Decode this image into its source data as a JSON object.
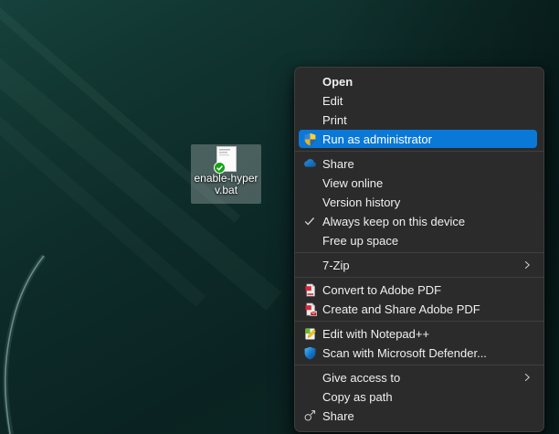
{
  "desktop": {
    "file_icon": {
      "label_lines": [
        "enable-hyper",
        "v.bat"
      ],
      "full_name": "enable-hyperv.bat",
      "sync_badge": "onedrive-synced-check-icon",
      "selected": true
    },
    "colors": {
      "wallpaper_base": "#0d2b29",
      "selection_tile": "rgba(158,168,168,0.42)"
    }
  },
  "context_menu": {
    "colors": {
      "background": "#2b2b2b",
      "highlight": "#0a78d7",
      "text": "#f0f0f0",
      "separator": "#3f3f3f"
    },
    "groups": [
      {
        "items": [
          {
            "label": "Open",
            "bold": true
          },
          {
            "label": "Edit"
          },
          {
            "label": "Print"
          },
          {
            "label": "Run as administrator",
            "icon": "uac-shield-icon",
            "highlighted": true
          }
        ]
      },
      {
        "items": [
          {
            "label": "Share",
            "icon": "onedrive-cloud-icon"
          },
          {
            "label": "View online"
          },
          {
            "label": "Version history"
          },
          {
            "label": "Always keep on this device",
            "icon": "check-icon"
          },
          {
            "label": "Free up space"
          }
        ]
      },
      {
        "items": [
          {
            "label": "7-Zip",
            "submenu": true
          }
        ]
      },
      {
        "items": [
          {
            "label": "Convert to Adobe PDF",
            "icon": "adobe-pdf-icon"
          },
          {
            "label": "Create and Share Adobe PDF",
            "icon": "adobe-pdf-share-icon"
          }
        ]
      },
      {
        "items": [
          {
            "label": "Edit with Notepad++",
            "icon": "notepadpp-icon"
          },
          {
            "label": "Scan with Microsoft Defender...",
            "icon": "defender-shield-icon"
          }
        ]
      },
      {
        "items": [
          {
            "label": "Give access to",
            "submenu": true
          },
          {
            "label": "Copy as path"
          },
          {
            "label": "Share",
            "icon": "share-icon"
          }
        ]
      }
    ]
  }
}
